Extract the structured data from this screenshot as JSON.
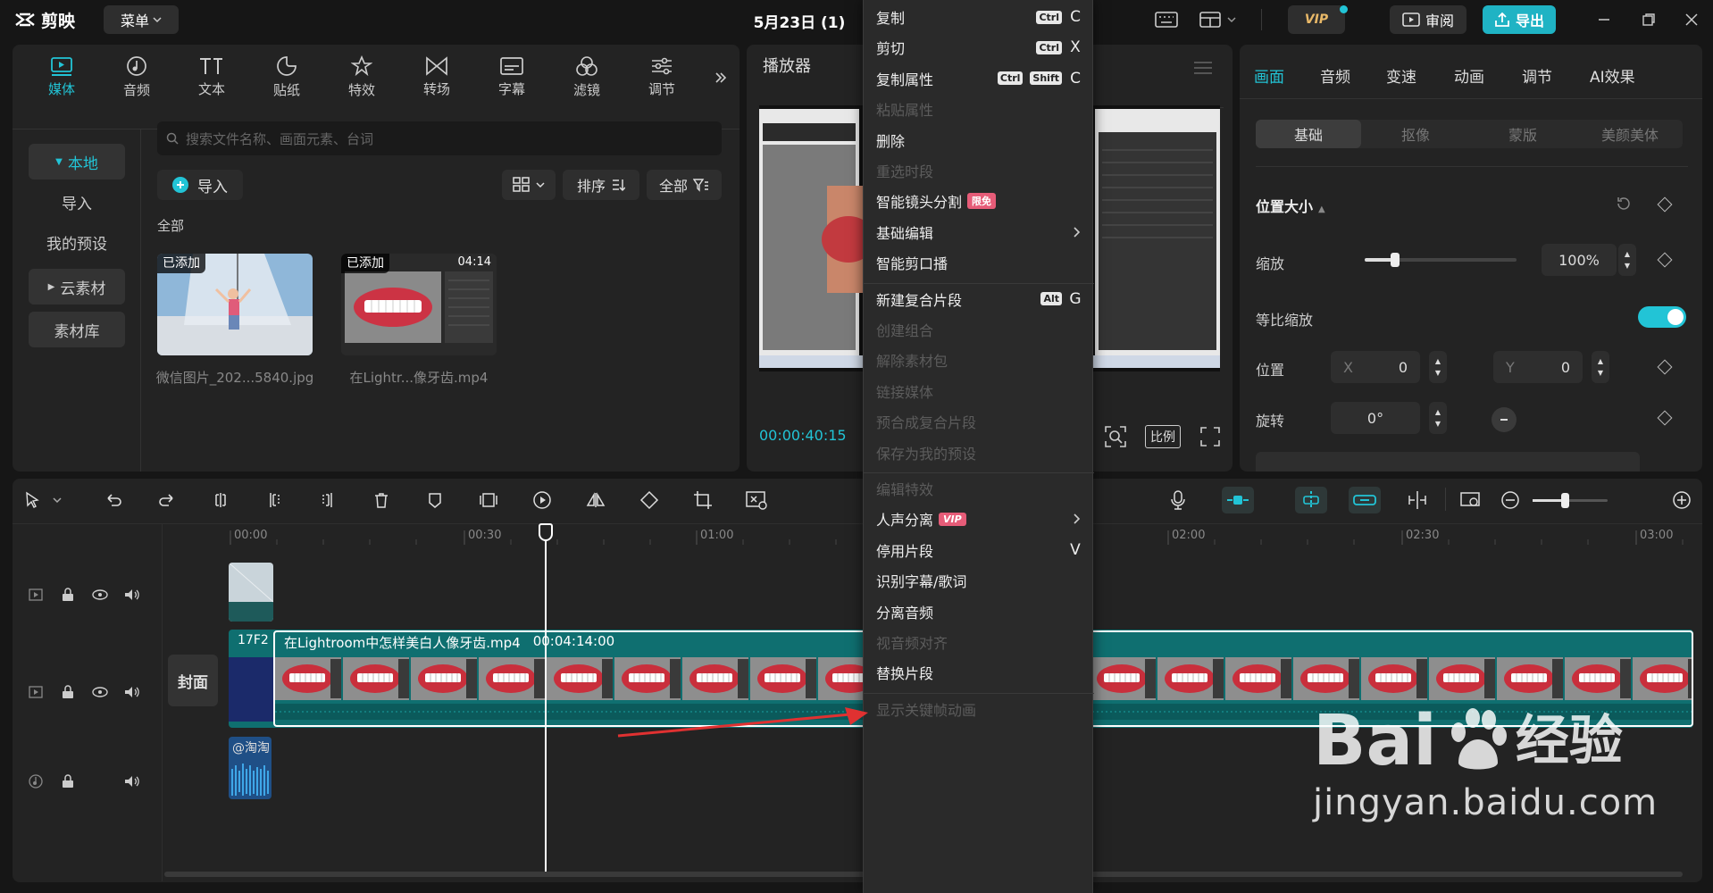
{
  "app": {
    "name": "剪映",
    "menu_label": "菜单",
    "project_title": "5月23日 (1)",
    "vip_label": "VIP",
    "review_label": "审阅",
    "export_label": "导出"
  },
  "media_tabs": [
    {
      "label": "媒体",
      "icon": "media-icon"
    },
    {
      "label": "音频",
      "icon": "audio-icon"
    },
    {
      "label": "文本",
      "icon": "text-icon"
    },
    {
      "label": "贴纸",
      "icon": "sticker-icon"
    },
    {
      "label": "特效",
      "icon": "effects-icon"
    },
    {
      "label": "转场",
      "icon": "transition-icon"
    },
    {
      "label": "字幕",
      "icon": "subtitle-icon"
    },
    {
      "label": "滤镜",
      "icon": "filter-icon"
    },
    {
      "label": "调节",
      "icon": "adjust-icon"
    }
  ],
  "media_side": {
    "local": "本地",
    "import": "导入",
    "my_presets": "我的预设",
    "cloud": "云素材",
    "library": "素材库"
  },
  "media_main": {
    "search_placeholder": "搜索文件名称、画面元素、台词",
    "import_label": "导入",
    "sort_label": "排序",
    "filter_label": "全部",
    "section_label": "全部",
    "items": [
      {
        "badge": "已添加",
        "name": "微信图片_202...5840.jpg",
        "duration": ""
      },
      {
        "badge": "已添加",
        "name": "在Lightr...像牙齿.mp4",
        "duration": "04:14"
      }
    ]
  },
  "player": {
    "title": "播放器",
    "time": "00:00:40:15",
    "ratio_label": "比例"
  },
  "props": {
    "tabs": [
      "画面",
      "音频",
      "变速",
      "动画",
      "调节",
      "AI效果"
    ],
    "subtabs": [
      "基础",
      "抠像",
      "蒙版",
      "美颜美体"
    ],
    "section": "位置大小",
    "scale_label": "缩放",
    "scale_value": "100%",
    "scale_level": 0.2,
    "uniform_label": "等比缩放",
    "position_label": "位置",
    "x_label": "X",
    "x_value": "0",
    "y_label": "Y",
    "y_value": "0",
    "rotate_label": "旋转",
    "rotate_value": "0°"
  },
  "timeline": {
    "ruler": [
      "00:00",
      "00:30",
      "01:00",
      "02:00",
      "02:30",
      "03:00"
    ],
    "cover_label": "封面",
    "main_clip_prefix": "17F2",
    "main_clip_title": "在Lightroom中怎样美白人像牙齿.mp4",
    "main_clip_duration": "00:04:14:00",
    "audio_clip_label": "@淘淘"
  },
  "context_menu": [
    {
      "label": "复制",
      "mod": [
        "Ctrl"
      ],
      "key": "C",
      "disabled": false
    },
    {
      "label": "剪切",
      "mod": [
        "Ctrl"
      ],
      "key": "X",
      "disabled": false
    },
    {
      "label": "复制属性",
      "mod": [
        "Ctrl",
        "Shift"
      ],
      "key": "C",
      "disabled": false
    },
    {
      "label": "粘贴属性",
      "disabled": true
    },
    {
      "label": "删除",
      "disabled": false
    },
    {
      "label": "重选时段",
      "disabled": true
    },
    {
      "label": "智能镜头分割",
      "tag": "限免",
      "disabled": false
    },
    {
      "label": "基础编辑",
      "submenu": true,
      "disabled": false
    },
    {
      "label": "智能剪口播",
      "disabled": false
    },
    {
      "sep": true
    },
    {
      "label": "新建复合片段",
      "mod": [
        "Alt"
      ],
      "key": "G",
      "disabled": false
    },
    {
      "label": "创建组合",
      "disabled": true
    },
    {
      "label": "解除素材包",
      "disabled": true
    },
    {
      "label": "链接媒体",
      "disabled": true
    },
    {
      "label": "预合成复合片段",
      "disabled": true
    },
    {
      "label": "保存为我的预设",
      "disabled": true
    },
    {
      "sep": true
    },
    {
      "label": "编辑特效",
      "disabled": true
    },
    {
      "label": "人声分离",
      "tag": "VIP",
      "submenu": true,
      "disabled": false
    },
    {
      "label": "停用片段",
      "key": "V",
      "disabled": false
    },
    {
      "label": "识别字幕/歌词",
      "disabled": false
    },
    {
      "label": "分离音频",
      "disabled": false
    },
    {
      "label": "视音频对齐",
      "disabled": true
    },
    {
      "label": "替换片段",
      "disabled": false
    },
    {
      "sep": true
    },
    {
      "label": "显示关键帧动画",
      "disabled": true
    }
  ],
  "watermark": {
    "brand": "Bai",
    "suffix": "经验",
    "url": "jingyan.baidu.com"
  },
  "colors": {
    "accent": "#22c4d6",
    "clip": "#0f6f70",
    "arrow": "#e03131"
  }
}
